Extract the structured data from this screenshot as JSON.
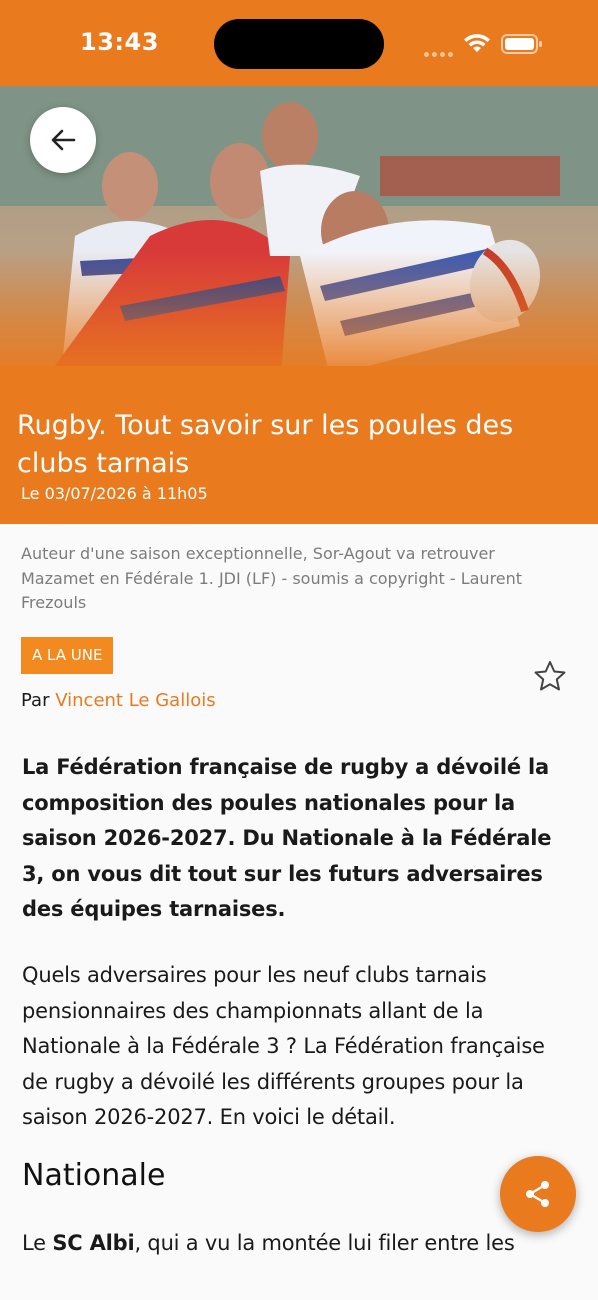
{
  "status_bar": {
    "time": "13:43"
  },
  "colors": {
    "accent": "#e97a1e",
    "badge": "#f28a1f"
  },
  "hero": {
    "image": "rugby-players-photo",
    "back_icon": "arrow-left-icon"
  },
  "article": {
    "title": "Rugby. Tout savoir sur les poules des clubs tarnais",
    "date": "Le 03/07/2026 à 11h05",
    "photo_caption": "Auteur d'une saison exceptionnelle, Sor-Agout va retrouver Mazamet en Fédérale 1. JDI (LF) - soumis a copyright - Laurent Frezouls",
    "section_badge": "A LA UNE",
    "byline_prefix": "Par",
    "author": "Vincent Le Gallois",
    "lead": "La Fédération française de rugby a dévoilé la composition des poules nationales pour la saison 2026-2027. Du Nationale à la Fédérale 3, on vous dit tout sur les futurs adversaires des équipes tarnaises.",
    "paragraph_1": "Quels adversaires pour les neuf clubs tarnais pensionnaires des championnats allant de la Nationale à la Fédérale 3 ? La Fédération française de rugby a dévoilé les différents groupes pour la saison 2026-2027. En voici le détail.",
    "subheading": "Nationale",
    "paragraph_2_prefix": "Le",
    "paragraph_2_club": "SC Albi",
    "paragraph_2_rest": ", qui a vu la montée lui filer entre les"
  },
  "icons": {
    "favorite": "star-outline-icon",
    "share": "share-icon"
  }
}
